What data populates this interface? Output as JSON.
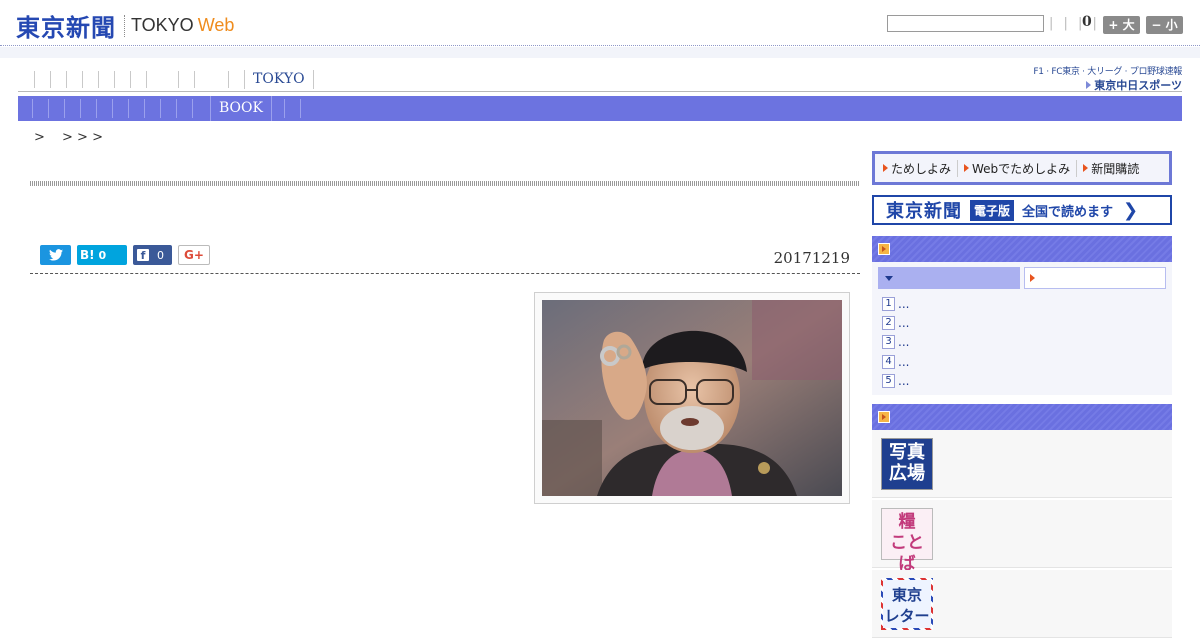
{
  "header": {
    "logo_jp": "東京新聞",
    "logo_en_1": "TOKYO",
    "logo_en_2": "Web",
    "search_bars": "| | | |",
    "font_count": "0",
    "font_up_label": "+ 大",
    "font_down_label": "− 小"
  },
  "nav": {
    "primary_tokyo": "TOKYO",
    "secondary_book": "BOOK",
    "chunichi_line1": "F1 · FC東京 · 大リーグ · プロ野球速報",
    "chunichi_line2": "東京中日スポーツ"
  },
  "breadcrumb": ">　 > > >",
  "article": {
    "date": "20171219",
    "share": {
      "hatena_count": "0",
      "facebook_count": "0",
      "gplus_label": "G+"
    },
    "photo_alt": "photo"
  },
  "sidebar": {
    "promo": [
      {
        "label": "ためしよみ"
      },
      {
        "label": "Webでためしよみ"
      },
      {
        "label": "新聞購読"
      }
    ],
    "epaper": {
      "jp": "東京新聞",
      "badge": "電子版",
      "text": "全国で読めます",
      "chevron": "❯"
    },
    "ranking": {
      "items": [
        {
          "num": "1",
          "text": "..."
        },
        {
          "num": "2",
          "text": "..."
        },
        {
          "num": "3",
          "text": "..."
        },
        {
          "num": "4",
          "text": "..."
        },
        {
          "num": "5",
          "text": "..."
        }
      ]
    },
    "thumbs": {
      "photo_line1": "写真",
      "photo_line2": "広場",
      "kate_line1": "糧",
      "kate_line2": "ことば",
      "letter_line1": "東京",
      "letter_line2": "レター"
    }
  },
  "colors": {
    "brand_blue": "#2548b2",
    "nav_purple": "#6c73e0",
    "accent_orange": "#ef8c1d"
  }
}
